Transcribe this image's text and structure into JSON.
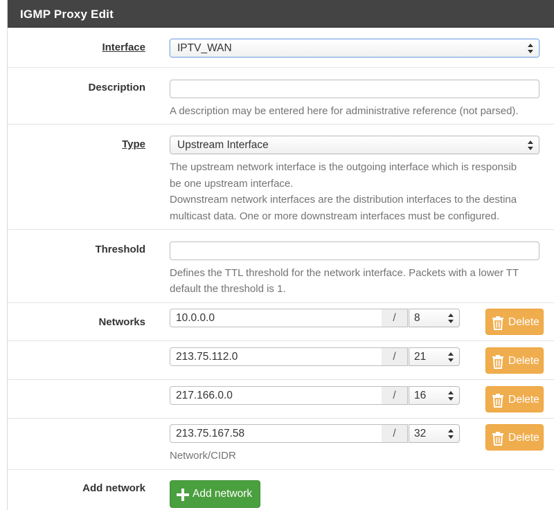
{
  "panel": {
    "title": "IGMP Proxy Edit"
  },
  "interface": {
    "label": "Interface",
    "value": "IPTV_WAN"
  },
  "description": {
    "label": "Description",
    "value": "",
    "help": "A description may be entered here for administrative reference (not parsed)."
  },
  "type": {
    "label": "Type",
    "value": "Upstream Interface",
    "help_lines": [
      "The upstream network interface is the outgoing interface which is responsib",
      "be one upstream interface.",
      "Downstream network interfaces are the distribution interfaces to the destina",
      "multicast data. One or more downstream interfaces must be configured."
    ]
  },
  "threshold": {
    "label": "Threshold",
    "value": "",
    "help_lines": [
      "Defines the TTL threshold for the network interface. Packets with a lower TT",
      "default the threshold is 1."
    ]
  },
  "networks": {
    "label": "Networks",
    "separator": "/",
    "delete_label": "Delete",
    "help": "Network/CIDR",
    "rows": [
      {
        "address": "10.0.0.0",
        "mask": "8"
      },
      {
        "address": "213.75.112.0",
        "mask": "21"
      },
      {
        "address": "217.166.0.0",
        "mask": "16"
      },
      {
        "address": "213.75.167.58",
        "mask": "32"
      }
    ]
  },
  "add_network": {
    "label": "Add network",
    "button_label": "Add network"
  },
  "colors": {
    "header_bg": "#444444",
    "delete_btn": "#f0ad4e",
    "add_btn": "#4a9f3e"
  }
}
